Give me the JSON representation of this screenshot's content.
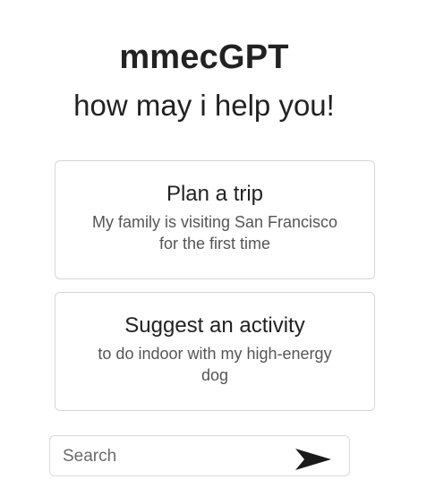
{
  "header": {
    "app_title": "mmecGPT",
    "greeting": "how may i help you!"
  },
  "suggestions": [
    {
      "title": "Plan a trip",
      "description": "My family is visiting San Francisco for the first time"
    },
    {
      "title": "Suggest an activity",
      "description": "to do indoor with my high-energy dog"
    }
  ],
  "search": {
    "placeholder": "Search",
    "value": "",
    "send_icon": "send-icon"
  },
  "colors": {
    "text": "#222222",
    "muted_text": "#555555",
    "border": "#d6d6d6",
    "background": "#ffffff"
  }
}
